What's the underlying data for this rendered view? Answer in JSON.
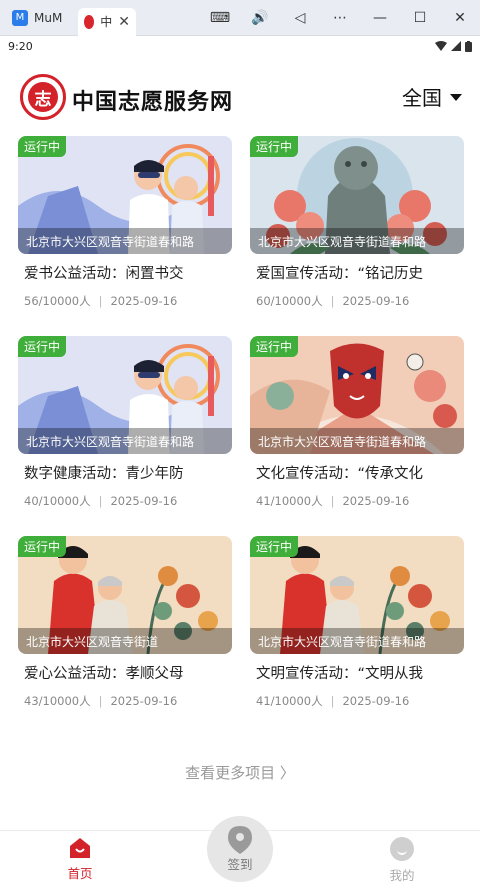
{
  "window": {
    "tab1_label": "MuM",
    "tab2_label": "中",
    "tab_close": "✕",
    "tools": [
      "⌨",
      "🔊",
      "◁",
      "⋯",
      "—",
      "☐",
      "✕"
    ]
  },
  "statusbar": {
    "time": "9:20"
  },
  "header": {
    "title": "中国志愿服务网",
    "region": "全国"
  },
  "cards": [
    {
      "badge": "运行中",
      "address": "北京市大兴区观音寺街道春和路",
      "title": "爱书公益活动：闲置书交",
      "participants": "56/10000人",
      "date": "2025-09-16",
      "scene": "science"
    },
    {
      "badge": "运行中",
      "address": "北京市大兴区观音寺街道春和路",
      "title": "爱国宣传活动：“铭记历史",
      "participants": "60/10000人",
      "date": "2025-09-16",
      "scene": "lion"
    },
    {
      "badge": "运行中",
      "address": "北京市大兴区观音寺街道春和路",
      "title": "数字健康活动：青少年防",
      "participants": "40/10000人",
      "date": "2025-09-16",
      "scene": "science"
    },
    {
      "badge": "运行中",
      "address": "北京市大兴区观音寺街道春和路",
      "title": "文化宣传活动：“传承文化",
      "participants": "41/10000人",
      "date": "2025-09-16",
      "scene": "opera"
    },
    {
      "badge": "运行中",
      "address": "北京市大兴区观音寺街道",
      "title": "爱心公益活动：孝顺父母",
      "participants": "43/10000人",
      "date": "2025-09-16",
      "scene": "elder"
    },
    {
      "badge": "运行中",
      "address": "北京市大兴区观音寺街道春和路",
      "title": "文明宣传活动：“文明从我",
      "participants": "41/10000人",
      "date": "2025-09-16",
      "scene": "elder"
    }
  ],
  "more_label": "查看更多项目 〉",
  "tabbar": {
    "home": "首页",
    "signin": "签到",
    "me": "我的"
  },
  "colors": {
    "brand_red": "#d3222a",
    "badge_green": "#3fae3a"
  }
}
